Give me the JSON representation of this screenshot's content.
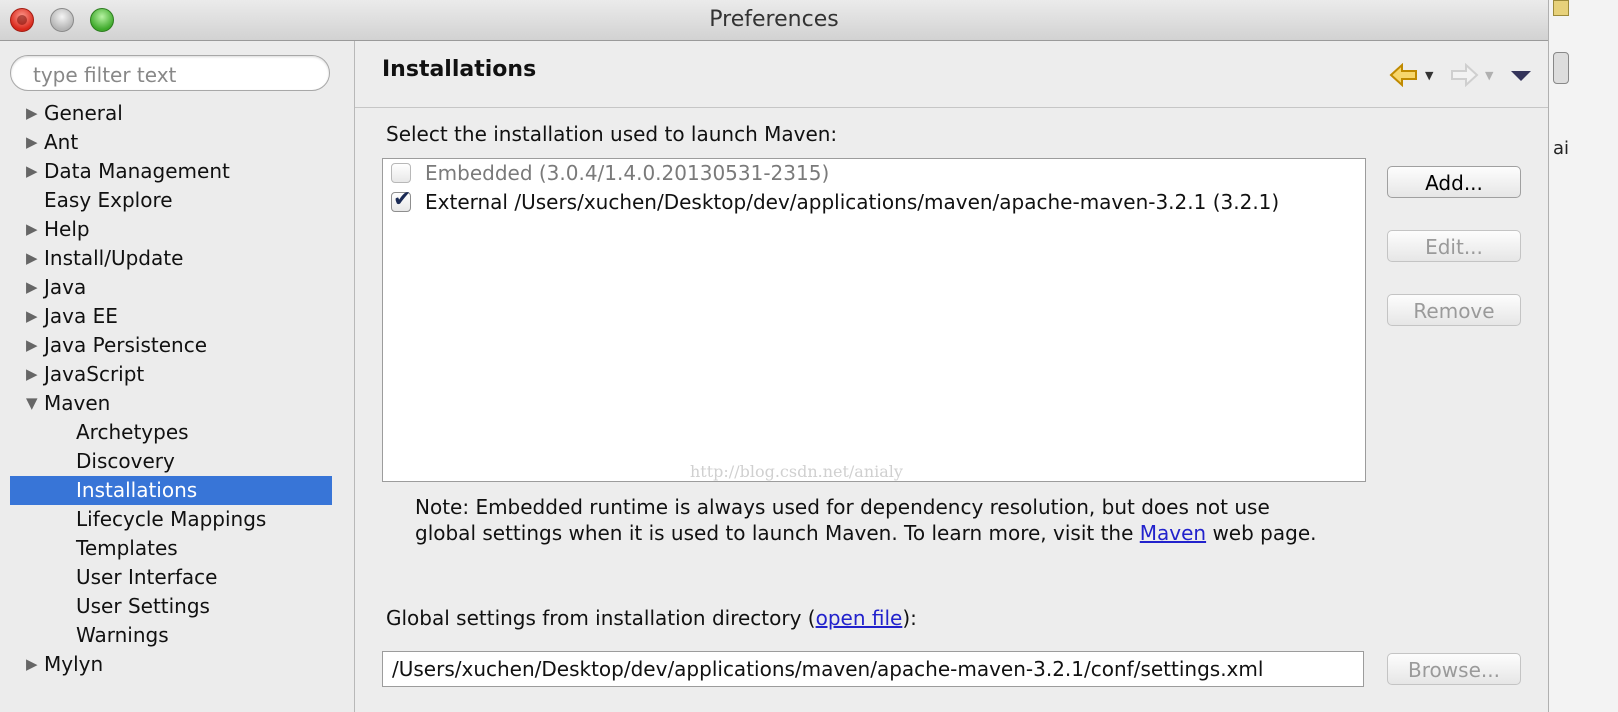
{
  "window": {
    "title": "Preferences",
    "edge_letter": "ai"
  },
  "sidebar": {
    "filter_placeholder": "type filter text",
    "items": [
      {
        "label": "General",
        "expanded": false,
        "child": false
      },
      {
        "label": "Ant",
        "expanded": false,
        "child": false
      },
      {
        "label": "Data Management",
        "expanded": false,
        "child": false
      },
      {
        "label": "Easy Explore",
        "expanded": null,
        "child": false
      },
      {
        "label": "Help",
        "expanded": false,
        "child": false
      },
      {
        "label": "Install/Update",
        "expanded": false,
        "child": false
      },
      {
        "label": "Java",
        "expanded": false,
        "child": false
      },
      {
        "label": "Java EE",
        "expanded": false,
        "child": false
      },
      {
        "label": "Java Persistence",
        "expanded": false,
        "child": false
      },
      {
        "label": "JavaScript",
        "expanded": false,
        "child": false
      },
      {
        "label": "Maven",
        "expanded": true,
        "child": false
      },
      {
        "label": "Archetypes",
        "child": true
      },
      {
        "label": "Discovery",
        "child": true
      },
      {
        "label": "Installations",
        "child": true,
        "selected": true
      },
      {
        "label": "Lifecycle Mappings",
        "child": true
      },
      {
        "label": "Templates",
        "child": true
      },
      {
        "label": "User Interface",
        "child": true
      },
      {
        "label": "User Settings",
        "child": true
      },
      {
        "label": "Warnings",
        "child": true
      },
      {
        "label": "Mylyn",
        "expanded": false,
        "child": false
      }
    ]
  },
  "main": {
    "title": "Installations",
    "select_label": "Select the installation used to launch Maven:",
    "installations": [
      {
        "label": "Embedded (3.0.4/1.4.0.20130531-2315)",
        "checked": false,
        "disabled": true
      },
      {
        "label": "External /Users/xuchen/Desktop/dev/applications/maven/apache-maven-3.2.1 (3.2.1)",
        "checked": true,
        "disabled": false
      }
    ],
    "watermark": "http://blog.csdn.net/anialy",
    "buttons": {
      "add": "Add...",
      "edit": "Edit...",
      "remove": "Remove",
      "browse": "Browse..."
    },
    "note_line1": "Note: Embedded runtime is always used for dependency resolution, but does not use",
    "note_line2_pre": "global settings when it is used to launch Maven. To learn more, visit the ",
    "note_link": "Maven",
    "note_line2_post": " web page.",
    "global_pre": "Global settings from installation directory (",
    "global_link": "open file",
    "global_post": "):",
    "global_path": "/Users/xuchen/Desktop/dev/applications/maven/apache-maven-3.2.1/conf/settings.xml"
  },
  "colors": {
    "selection": "#3875d7",
    "link": "#2222cc",
    "back_arrow": "#e0a000"
  },
  "icons": [
    "close-button",
    "minimize-button",
    "zoom-button",
    "back-arrow-icon",
    "forward-arrow-icon",
    "view-menu-icon",
    "checkbox"
  ]
}
